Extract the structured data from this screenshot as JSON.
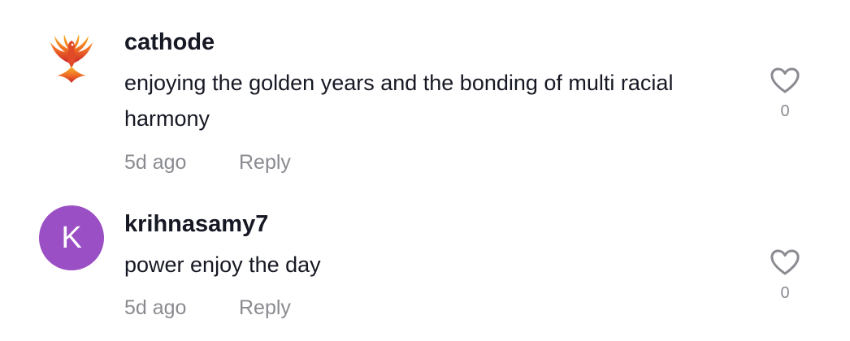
{
  "comments": [
    {
      "username": "cathode",
      "avatar_icon": "phoenix-logo",
      "text": "enjoying the golden years and the bonding of multi racial harmony",
      "time": "5d ago",
      "reply_label": "Reply",
      "likes": "0"
    },
    {
      "username": "krihnasamy7",
      "avatar_letter": "K",
      "avatar_color": "#9b4fc4",
      "text": "power enjoy the day",
      "time": "5d ago",
      "reply_label": "Reply",
      "likes": "0"
    }
  ],
  "colors": {
    "username": "#161823",
    "meta": "#8a8b91"
  }
}
